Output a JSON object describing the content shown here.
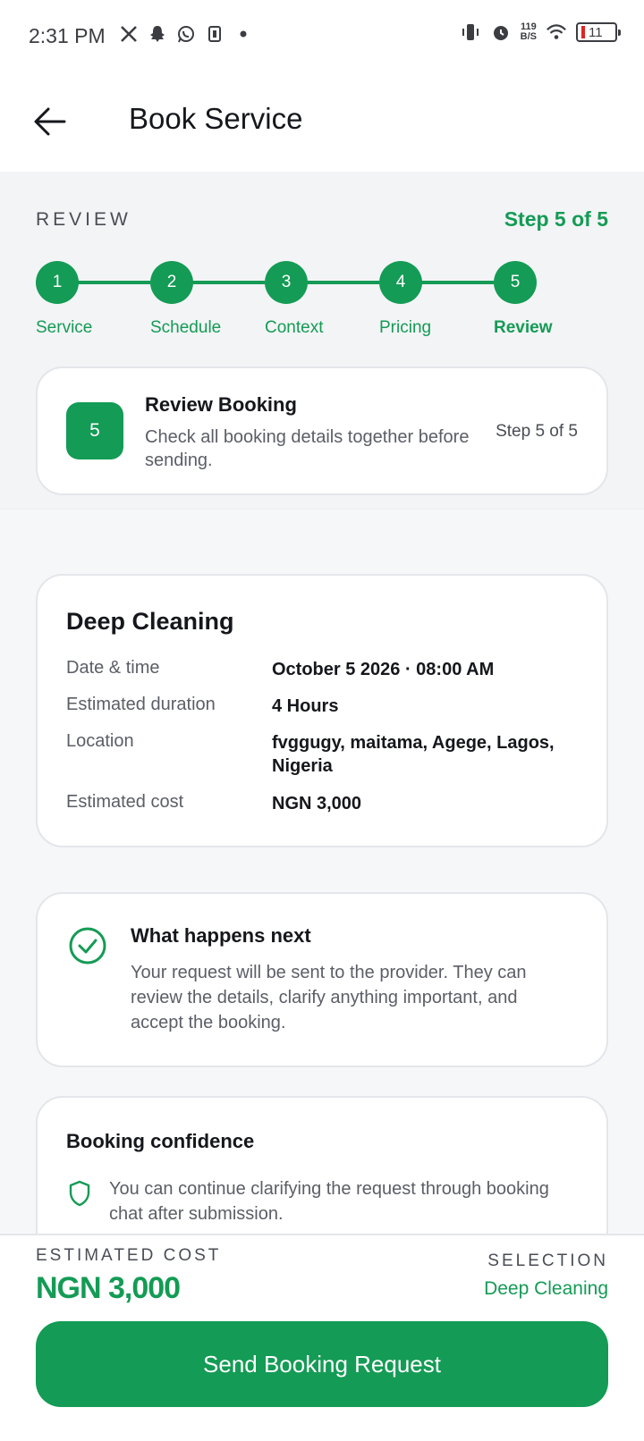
{
  "status_bar": {
    "time": "2:31 PM",
    "netspeed_value": "119",
    "netspeed_unit": "B/S",
    "battery_level": "11"
  },
  "app_bar": {
    "title": "Book Service"
  },
  "progress": {
    "section_label": "REVIEW",
    "step_count": "Step 5 of 5",
    "steps": [
      {
        "number": "1",
        "label": "Service"
      },
      {
        "number": "2",
        "label": "Schedule"
      },
      {
        "number": "3",
        "label": "Context"
      },
      {
        "number": "4",
        "label": "Pricing"
      },
      {
        "number": "5",
        "label": "Review"
      }
    ]
  },
  "review_card": {
    "badge": "5",
    "title": "Review Booking",
    "description": "Check all booking details together before sending.",
    "step": "Step 5 of 5"
  },
  "service_card": {
    "title": "Deep Cleaning",
    "rows": [
      {
        "label": "Date & time",
        "value": "October 5 2026 · 08:00 AM"
      },
      {
        "label": "Estimated duration",
        "value": "4 Hours"
      },
      {
        "label": "Location",
        "value": "fvggugy, maitama, Agege, Lagos, Nigeria"
      },
      {
        "label": "Estimated cost",
        "value": "NGN 3,000"
      }
    ]
  },
  "next_card": {
    "title": "What happens next",
    "description": "Your request will be sent to the provider. They can review the details, clarify anything important, and accept the booking."
  },
  "confidence_card": {
    "title": "Booking confidence",
    "item": "You can continue clarifying the request through booking chat after submission."
  },
  "footer": {
    "estimated_cost_label": "ESTIMATED COST",
    "estimated_cost_value": "NGN 3,000",
    "selection_label": "SELECTION",
    "selection_value": "Deep Cleaning",
    "cta_label": "Send Booking Request"
  },
  "colors": {
    "accent": "#149b55",
    "text": "#16171c",
    "muted": "#5b5e66",
    "background": "#f6f7f9",
    "battery_low": "#e02424"
  },
  "icons": [
    "x-icon",
    "snapchat-icon",
    "whatsapp-icon",
    "app-icon",
    "vibrate-icon",
    "alarm-icon",
    "wifi-icon",
    "back-arrow-icon",
    "check-circle-icon",
    "shield-icon"
  ]
}
